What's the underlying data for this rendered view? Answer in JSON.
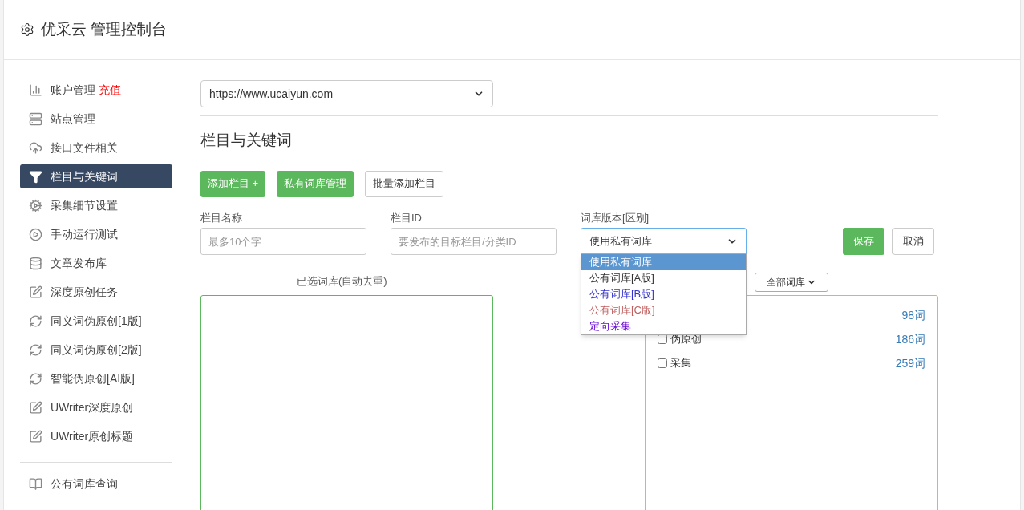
{
  "header": {
    "title": "优采云 管理控制台"
  },
  "sidebar": {
    "items": [
      {
        "kind": "chart",
        "label": "账户管理",
        "badge": "充值",
        "selected": false
      },
      {
        "kind": "server",
        "label": "站点管理",
        "selected": false
      },
      {
        "kind": "cloud",
        "label": "接口文件相关",
        "selected": false
      },
      {
        "kind": "filter",
        "label": "栏目与关键词",
        "selected": true
      },
      {
        "kind": "gears",
        "label": "采集细节设置",
        "selected": false
      },
      {
        "kind": "play",
        "label": "手动运行测试",
        "selected": false
      },
      {
        "kind": "database",
        "label": "文章发布库",
        "selected": false
      },
      {
        "kind": "edit",
        "label": "深度原创任务",
        "selected": false
      },
      {
        "kind": "refresh",
        "label": "同义词伪原创[1版]",
        "selected": false
      },
      {
        "kind": "refresh",
        "label": "同义词伪原创[2版]",
        "selected": false
      },
      {
        "kind": "refresh",
        "label": "智能伪原创[AI版]",
        "selected": false
      },
      {
        "kind": "edit",
        "label": "UWriter深度原创",
        "selected": false
      },
      {
        "kind": "edit",
        "label": "UWriter原创标题",
        "selected": false
      },
      {
        "kind": "divider"
      },
      {
        "kind": "book",
        "label": "公有词库查询",
        "selected": false
      }
    ]
  },
  "site_select": {
    "value": "https://www.ucaiyun.com"
  },
  "section_title": "栏目与关键词",
  "buttons": [
    {
      "kind": "green",
      "label": "添加栏目 +"
    },
    {
      "kind": "green",
      "label": "私有词库管理"
    },
    {
      "kind": "plain",
      "label": "批量添加栏目"
    }
  ],
  "form": {
    "name": {
      "label": "栏目名称",
      "placeholder": "最多10个字"
    },
    "id": {
      "label": "栏目ID",
      "placeholder": "要发布的目标栏目/分类ID"
    },
    "version": {
      "label": "词库版本[区别]",
      "value": "使用私有词库",
      "expanded": true,
      "options": [
        {
          "label": "使用私有词库",
          "selected": true,
          "color": "#ffffff"
        },
        {
          "label": "公有词库[A版]",
          "selected": false,
          "color": "#333333"
        },
        {
          "label": "公有词库[B版]",
          "selected": false,
          "color": "#3333cc"
        },
        {
          "label": "公有词库[C版]",
          "selected": false,
          "color": "#c06060"
        },
        {
          "label": "定向采集",
          "selected": false,
          "color": "#6a0dd8"
        }
      ]
    },
    "save": "保存",
    "cancel": "取消"
  },
  "selected_box": {
    "label": "已选词库(自动去重)"
  },
  "library_box": {
    "filter": "全部词库",
    "items": [
      {
        "count": "98词"
      },
      {
        "label": "伪原创",
        "count": "186词",
        "checked": false
      },
      {
        "label": "采集",
        "count": "259词",
        "checked": false
      }
    ]
  }
}
